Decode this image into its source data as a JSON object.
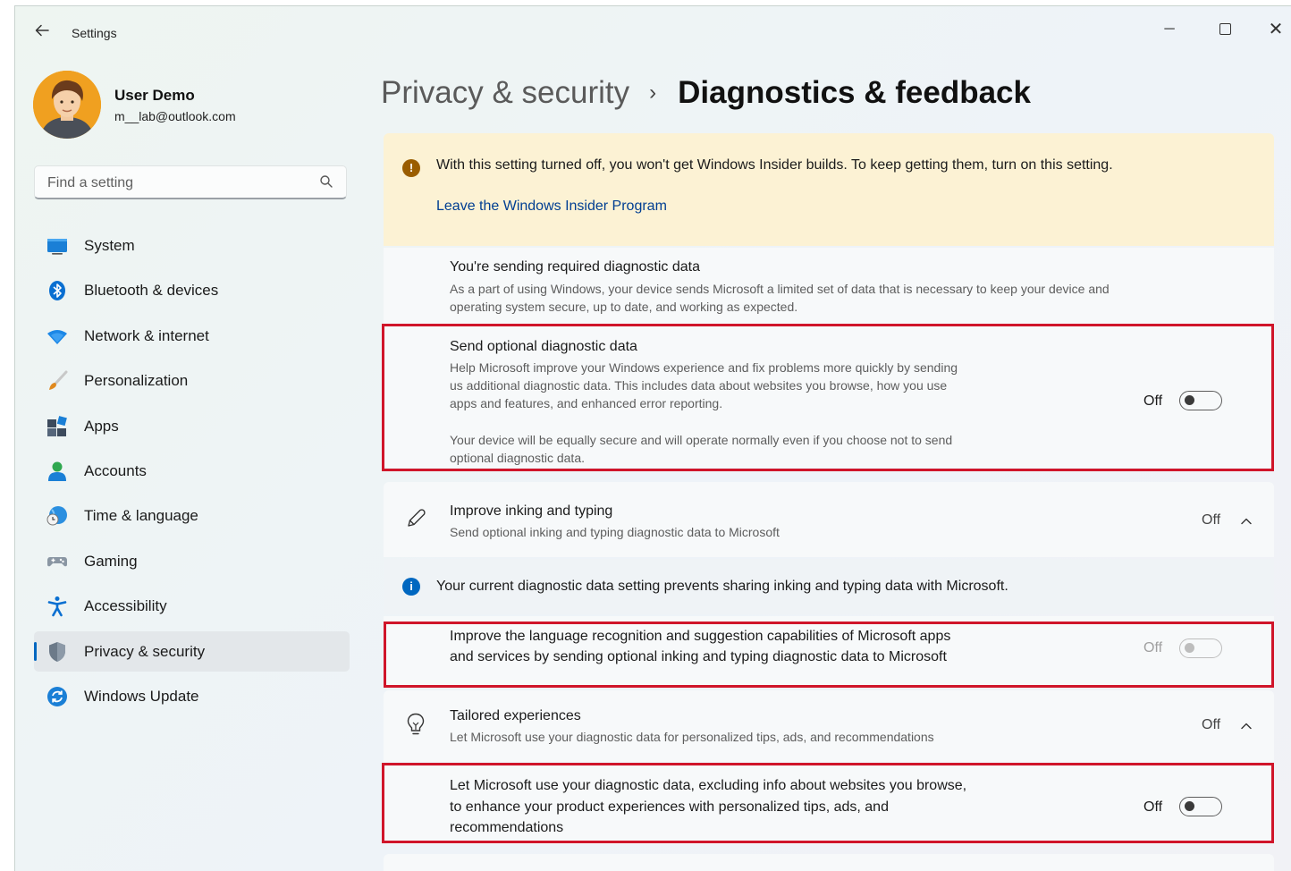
{
  "window": {
    "title": "Settings",
    "controls": {
      "minimize": "─",
      "close": "✕"
    }
  },
  "user": {
    "name": "User Demo",
    "email": "m__lab@outlook.com"
  },
  "search": {
    "placeholder": "Find a setting",
    "value": ""
  },
  "sidebar": {
    "items": [
      {
        "label": "System",
        "icon": "system-icon"
      },
      {
        "label": "Bluetooth & devices",
        "icon": "bluetooth-icon"
      },
      {
        "label": "Network & internet",
        "icon": "wifi-icon"
      },
      {
        "label": "Personalization",
        "icon": "brush-icon"
      },
      {
        "label": "Apps",
        "icon": "apps-icon"
      },
      {
        "label": "Accounts",
        "icon": "accounts-icon"
      },
      {
        "label": "Time & language",
        "icon": "globe-clock-icon"
      },
      {
        "label": "Gaming",
        "icon": "gamepad-icon"
      },
      {
        "label": "Accessibility",
        "icon": "accessibility-icon"
      },
      {
        "label": "Privacy & security",
        "icon": "shield-icon",
        "selected": true
      },
      {
        "label": "Windows Update",
        "icon": "update-icon"
      }
    ]
  },
  "breadcrumb": {
    "parent": "Privacy & security",
    "separator": "›",
    "current": "Diagnostics & feedback"
  },
  "insider_warning": {
    "icon": "warning-icon",
    "text": "With this setting turned off, you won't get Windows Insider builds. To keep getting them, turn on this setting.",
    "link": "Leave the Windows Insider Program"
  },
  "required_data": {
    "title": "You're sending required diagnostic data",
    "desc_line1": "As a part of using Windows, your device sends Microsoft a limited set of data that is necessary to keep your device and",
    "desc_line2": "operating system secure, up to date, and working as expected."
  },
  "optional_data": {
    "title": "Send optional diagnostic data",
    "desc_line1": "Help Microsoft improve your Windows experience and fix problems more quickly by sending",
    "desc_line2": "us additional diagnostic data. This includes data about websites you browse, how you use",
    "desc_line3": "apps and features, and enhanced error reporting.",
    "note_line1": "Your device will be equally secure and will operate normally even if you choose not to send",
    "note_line2": "optional diagnostic data.",
    "toggle_state": "Off",
    "enabled": false
  },
  "inking": {
    "title": "Improve inking and typing",
    "desc": "Send optional inking and typing diagnostic data to Microsoft",
    "state": "Off",
    "icon": "pen-icon",
    "info_text": "Your current diagnostic data setting prevents sharing inking and typing data with Microsoft.",
    "sub_line1": "Improve the language recognition and suggestion capabilities of Microsoft apps",
    "sub_line2": "and services by sending optional inking and typing diagnostic data to Microsoft",
    "sub_toggle_state": "Off",
    "sub_toggle_disabled": true
  },
  "tailored": {
    "title": "Tailored experiences",
    "desc": "Let Microsoft use your diagnostic data for personalized tips, ads, and recommendations",
    "state": "Off",
    "icon": "lightbulb-icon",
    "sub_line1": "Let Microsoft use your diagnostic data, excluding info about websites you browse,",
    "sub_line2": "to enhance your product experiences with personalized tips, ads, and",
    "sub_line3": "recommendations",
    "sub_toggle_state": "Off"
  },
  "colors": {
    "accent": "#0067c0",
    "warning_bg": "#fcf2d4",
    "highlight_box": "#d0152a"
  }
}
